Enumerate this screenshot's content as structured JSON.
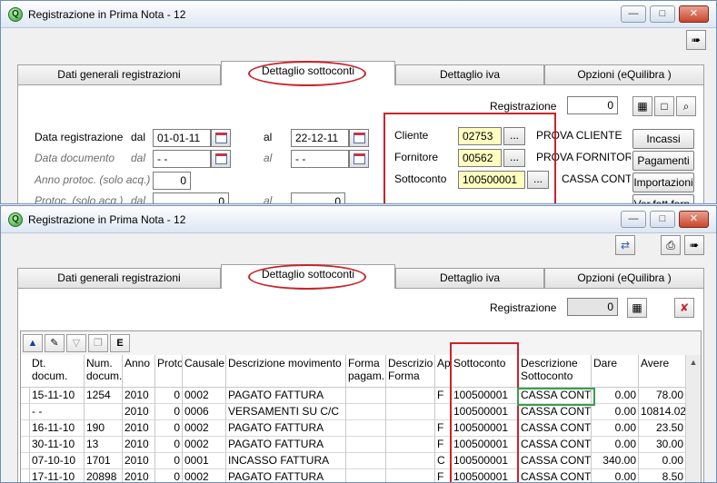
{
  "window1": {
    "title": "Registrazione in Prima Nota - 12",
    "tabs": [
      "Dati generali registrazioni",
      "Dettaglio sottoconti",
      "Dettaglio iva",
      "Opzioni (eQuilibra )"
    ],
    "registrazione_label": "Registrazione",
    "registrazione_value": "0",
    "data_registrazione_label": "Data registrazione",
    "dal_label": "dal",
    "al_label": "al",
    "data_reg_dal": "01-01-11",
    "data_reg_al": "22-12-11",
    "data_documento_label": "Data documento",
    "data_doc_dal": "- -",
    "data_doc_al": "- -",
    "anno_protoc_label": "Anno protoc. (solo acq.)",
    "anno_protoc_value": "0",
    "protoc_label": "Protoc. (solo acq.)",
    "protoc_dal": "0",
    "protoc_al": "0",
    "cliente_label": "Cliente",
    "cliente_code": "02753",
    "cliente_name": "PROVA CLIENTE",
    "fornitore_label": "Fornitore",
    "fornitore_code": "00562",
    "fornitore_name": "PROVA FORNITOR",
    "sottoconto_label": "Sottoconto",
    "sottoconto_code": "100500001",
    "sottoconto_name": "CASSA CONT",
    "dots": "...",
    "side_buttons": [
      "Incassi",
      "Pagamenti",
      "Importazioni",
      "Ver.fatt.forn."
    ]
  },
  "window2": {
    "title": "Registrazione in Prima Nota - 12",
    "tabs": [
      "Dati generali registrazioni",
      "Dettaglio sottoconti",
      "Dettaglio iva",
      "Opzioni (eQuilibra )"
    ],
    "registrazione_label": "Registrazione",
    "registrazione_value": "0",
    "columns": [
      "Dt. docum.",
      "Num. docum.",
      "Anno",
      "Proto",
      "Causale",
      "Descrizione movimento",
      "Forma pagam.",
      "Descrizio Forma",
      "App",
      "Sottoconto",
      "Descrizione Sottoconto",
      "Dare",
      "Avere"
    ],
    "rows": [
      [
        "15-11-10",
        "1254",
        "2010",
        "0",
        "0002",
        "PAGATO FATTURA",
        "",
        "",
        "F",
        "100500001",
        "CASSA CONT",
        "0.00",
        "78.00"
      ],
      [
        "- -",
        "",
        "2010",
        "0",
        "0006",
        "VERSAMENTI SU C/C",
        "",
        "",
        "",
        "100500001",
        "CASSA CONT.",
        "0.00",
        "10814.02"
      ],
      [
        "16-11-10",
        "190",
        "2010",
        "0",
        "0002",
        "PAGATO FATTURA",
        "",
        "",
        "F",
        "100500001",
        "CASSA CONT.",
        "0.00",
        "23.50"
      ],
      [
        "30-11-10",
        "13",
        "2010",
        "0",
        "0002",
        "PAGATO FATTURA",
        "",
        "",
        "F",
        "100500001",
        "CASSA CONT.",
        "0.00",
        "30.00"
      ],
      [
        "07-10-10",
        "1701",
        "2010",
        "0",
        "0001",
        "INCASSO FATTURA",
        "",
        "",
        "C",
        "100500001",
        "CASSA CONT.",
        "340.00",
        "0.00"
      ],
      [
        "17-11-10",
        "20898",
        "2010",
        "0",
        "0002",
        "PAGATO FATTURA",
        "",
        "",
        "F",
        "100500001",
        "CASSA CONT.",
        "0.00",
        "8.50"
      ]
    ]
  },
  "icons": {
    "app": "equilibra-logo-icon",
    "exit": "exit-door-icon",
    "refresh": "refresh-arrows-icon",
    "print": "printer-icon"
  },
  "colors": {
    "highlight_red": "#c8242c",
    "highlight_green": "#3aa04a",
    "field_yellow": "#ffffc0"
  }
}
